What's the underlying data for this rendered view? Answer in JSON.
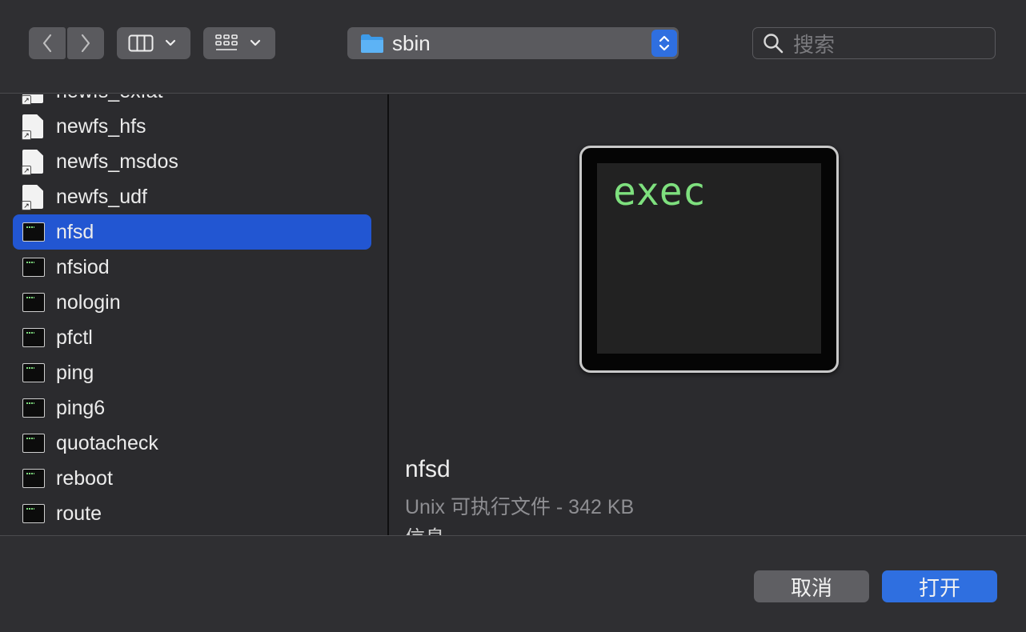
{
  "toolbar": {
    "back_icon": "chevron-left-icon",
    "forward_icon": "chevron-right-icon",
    "view_icon": "columns-view-icon",
    "group_icon": "group-grid-icon",
    "location": "sbin",
    "search_placeholder": "搜索"
  },
  "files": [
    {
      "name": "newfs_exfat",
      "kind": "alias"
    },
    {
      "name": "newfs_hfs",
      "kind": "alias"
    },
    {
      "name": "newfs_msdos",
      "kind": "alias"
    },
    {
      "name": "newfs_udf",
      "kind": "alias"
    },
    {
      "name": "nfsd",
      "kind": "exec",
      "selected": true
    },
    {
      "name": "nfsiod",
      "kind": "exec"
    },
    {
      "name": "nologin",
      "kind": "exec"
    },
    {
      "name": "pfctl",
      "kind": "exec"
    },
    {
      "name": "ping",
      "kind": "exec"
    },
    {
      "name": "ping6",
      "kind": "exec"
    },
    {
      "name": "quotacheck",
      "kind": "exec"
    },
    {
      "name": "reboot",
      "kind": "exec"
    },
    {
      "name": "route",
      "kind": "exec"
    }
  ],
  "preview": {
    "icon_text": "exec",
    "name": "nfsd",
    "kind_size": "Unix 可执行文件 - 342 KB",
    "next_section": "信息"
  },
  "buttons": {
    "cancel": "取消",
    "open": "打开"
  },
  "colors": {
    "accent": "#2f6fe0",
    "selection": "#2256d2",
    "background": "#2b2b2e"
  }
}
